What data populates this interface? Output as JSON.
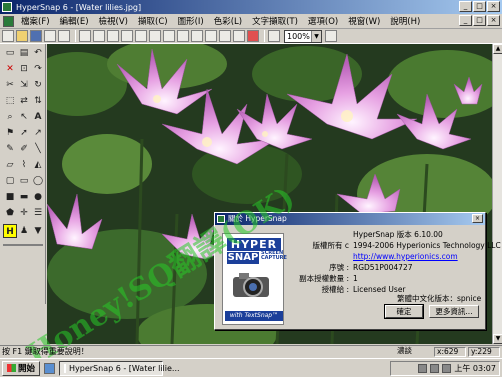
{
  "window": {
    "title": "HyperSnap 6 - [Water lilies.jpg]",
    "controls": [
      "_",
      "□",
      "×"
    ]
  },
  "menu": {
    "items": [
      "檔案(F)",
      "編輯(E)",
      "檢視(V)",
      "擷取(C)",
      "圖形(I)",
      "色彩(L)",
      "文字擷取(T)",
      "選項(O)",
      "視窗(W)",
      "說明(H)"
    ],
    "controls": [
      "_",
      "□",
      "×"
    ]
  },
  "toolbar": {
    "zoom_value": "100%"
  },
  "tools": {
    "text_tool": "A",
    "highlight_tool": "H"
  },
  "image": {
    "filename": "Water lilies.jpg"
  },
  "watermark": {
    "text": "Honey!SQ翻譯(OK)"
  },
  "dialog": {
    "title": "關於 HyperSnap",
    "close": "×",
    "logo": {
      "line1": "HYPER",
      "line2": "SNAP",
      "sub": "SCREEN CAPTURE",
      "footer": "with TextSnap™"
    },
    "info": [
      {
        "label": "",
        "value": "HyperSnap 版本 6.10.00"
      },
      {
        "label": "版權所有 c",
        "value": "1994-2006 Hyperionics Technology LLC"
      },
      {
        "label": "",
        "value": "http://www.hyperionics.com"
      },
      {
        "label": "序號 :",
        "value": "RGD51P004727"
      },
      {
        "label": "副本授權數量 :",
        "value": "1"
      },
      {
        "label": "授權給 :",
        "value": "Licensed User"
      }
    ],
    "lang_label": "繁體中文化版本：",
    "lang_value": "spnice",
    "ok": "確定",
    "more": "更多資訊..."
  },
  "status": {
    "help": "按 F1 鍵取得重要說明！",
    "label": "濃談",
    "x": "x:629",
    "y": "y:229"
  },
  "taskbar": {
    "start": "開始",
    "task": "HyperSnap 6 - [Water lilie...",
    "time": "上午 03:07"
  }
}
